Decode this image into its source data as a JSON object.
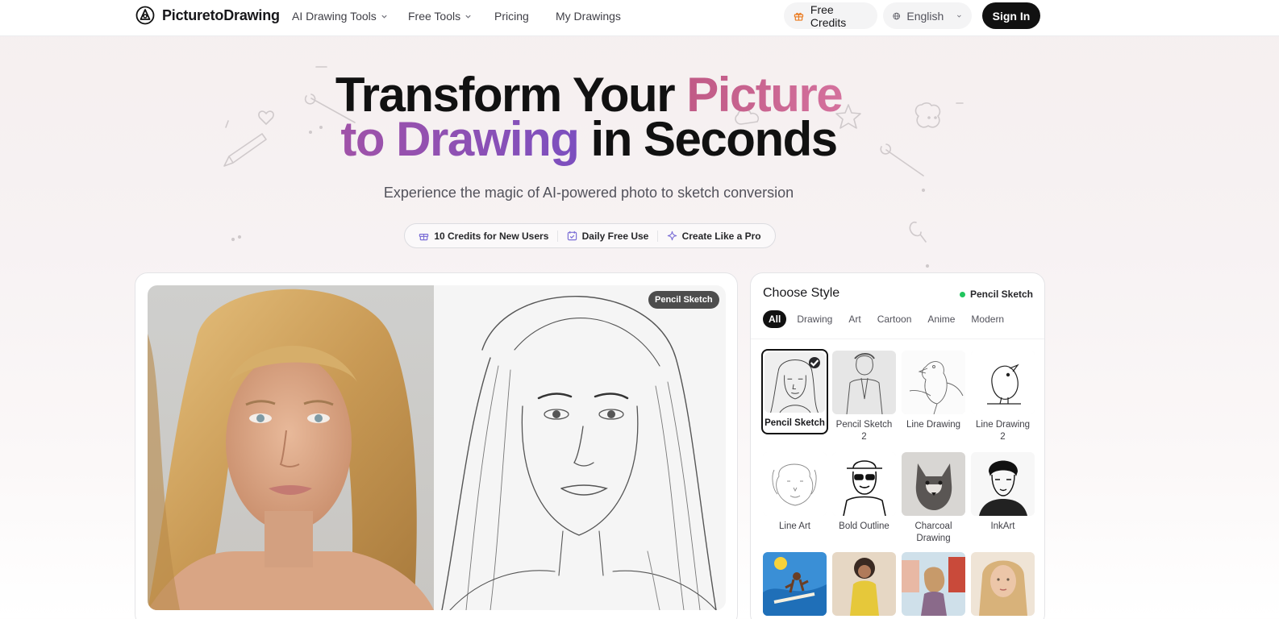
{
  "header": {
    "brand": "PicturetoDrawing",
    "nav": [
      {
        "label": "AI Drawing Tools"
      },
      {
        "label": "Free Tools"
      },
      {
        "label": "Pricing"
      },
      {
        "label": "My Drawings"
      }
    ],
    "free_credits_label": "Free Credits",
    "language_label": "English",
    "sign_in_label": "Sign In"
  },
  "hero": {
    "line1_prefix": "Transform Your ",
    "line1_accent": "Picture",
    "line2_accent": "to Drawing",
    "line2_suffix": " in Seconds",
    "subtitle": "Experience the magic of AI-powered photo to sketch conversion",
    "features": [
      {
        "label": "10 Credits for New Users",
        "icon": "gift-icon"
      },
      {
        "label": "Daily Free Use",
        "icon": "calendar-check-icon"
      },
      {
        "label": "Create Like a Pro",
        "icon": "sparkle-icon"
      }
    ]
  },
  "preview": {
    "badge": "Pencil Sketch"
  },
  "style_panel": {
    "title": "Choose Style",
    "selected_label": "Pencil Sketch",
    "tabs": [
      {
        "label": "All",
        "active": true
      },
      {
        "label": "Drawing"
      },
      {
        "label": "Art"
      },
      {
        "label": "Cartoon"
      },
      {
        "label": "Anime"
      },
      {
        "label": "Modern"
      }
    ],
    "styles": [
      {
        "label": "Pencil Sketch",
        "selected": true
      },
      {
        "label": "Pencil Sketch 2"
      },
      {
        "label": "Line Drawing"
      },
      {
        "label": "Line Drawing 2"
      },
      {
        "label": "Line Art"
      },
      {
        "label": "Bold Outline"
      },
      {
        "label": "Charcoal Drawing"
      },
      {
        "label": "InkArt"
      }
    ]
  },
  "colors": {
    "accent_pink": "#c05a86",
    "accent_purple": "#8a50b8",
    "primary_dark": "#111111",
    "status_green": "#22c55e",
    "credits_orange": "#ea7a1f"
  }
}
